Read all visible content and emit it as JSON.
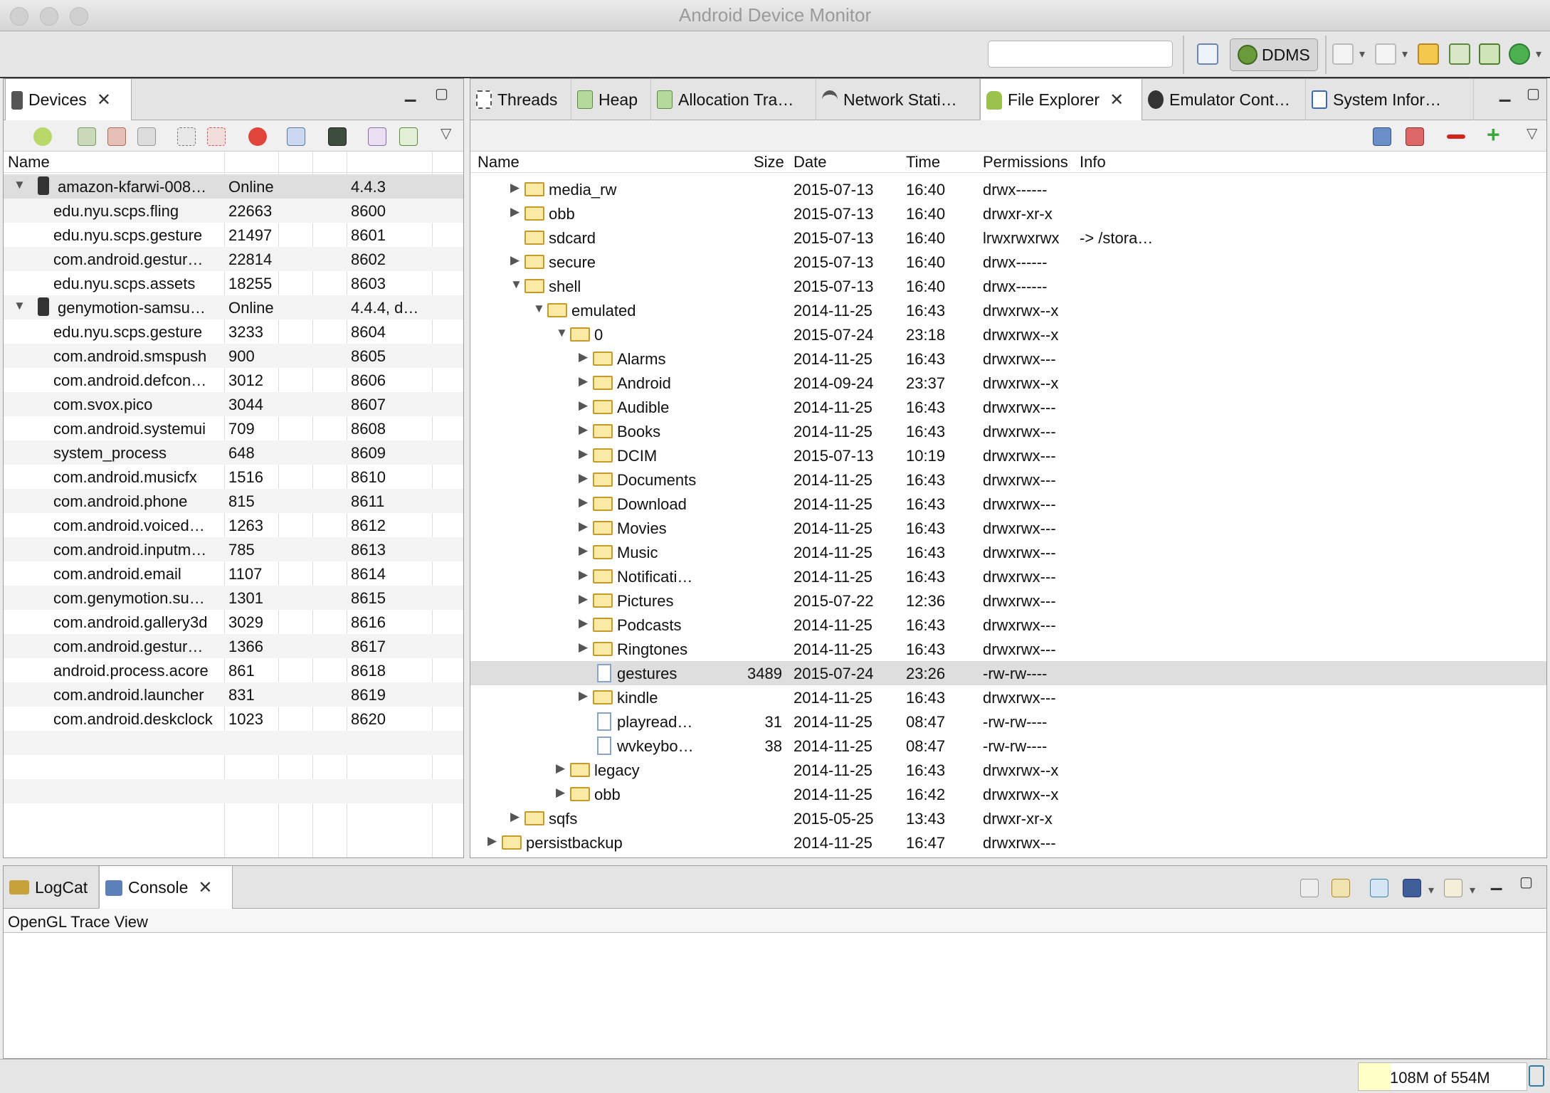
{
  "window": {
    "title": "Android Device Monitor"
  },
  "toolbar": {
    "perspective_label": "DDMS"
  },
  "devices": {
    "tab_label": "Devices",
    "columns": [
      "Name",
      "",
      "",
      "",
      ""
    ],
    "rows": [
      {
        "type": "device",
        "name": "amazon-kfarwi-008…",
        "c2": "Online",
        "c3": "",
        "c4": "4.4.3"
      },
      {
        "type": "process",
        "name": "edu.nyu.scps.fling",
        "c2": "22663",
        "c3": "",
        "c4": "8600"
      },
      {
        "type": "process",
        "name": "edu.nyu.scps.gesture",
        "c2": "21497",
        "c3": "",
        "c4": "8601"
      },
      {
        "type": "process",
        "name": "com.android.gestur…",
        "c2": "22814",
        "c3": "",
        "c4": "8602"
      },
      {
        "type": "process",
        "name": "edu.nyu.scps.assets",
        "c2": "18255",
        "c3": "",
        "c4": "8603"
      },
      {
        "type": "device",
        "name": "genymotion-samsu…",
        "c2": "Online",
        "c3": "",
        "c4": "4.4.4, d…"
      },
      {
        "type": "process",
        "name": "edu.nyu.scps.gesture",
        "c2": "3233",
        "c3": "",
        "c4": "8604"
      },
      {
        "type": "process",
        "name": "com.android.smspush",
        "c2": "900",
        "c3": "",
        "c4": "8605"
      },
      {
        "type": "process",
        "name": "com.android.defcon…",
        "c2": "3012",
        "c3": "",
        "c4": "8606"
      },
      {
        "type": "process",
        "name": "com.svox.pico",
        "c2": "3044",
        "c3": "",
        "c4": "8607"
      },
      {
        "type": "process",
        "name": "com.android.systemui",
        "c2": "709",
        "c3": "",
        "c4": "8608"
      },
      {
        "type": "process",
        "name": "system_process",
        "c2": "648",
        "c3": "",
        "c4": "8609"
      },
      {
        "type": "process",
        "name": "com.android.musicfx",
        "c2": "1516",
        "c3": "",
        "c4": "8610"
      },
      {
        "type": "process",
        "name": "com.android.phone",
        "c2": "815",
        "c3": "",
        "c4": "8611"
      },
      {
        "type": "process",
        "name": "com.android.voiced…",
        "c2": "1263",
        "c3": "",
        "c4": "8612"
      },
      {
        "type": "process",
        "name": "com.android.inputm…",
        "c2": "785",
        "c3": "",
        "c4": "8613"
      },
      {
        "type": "process",
        "name": "com.android.email",
        "c2": "1107",
        "c3": "",
        "c4": "8614"
      },
      {
        "type": "process",
        "name": "com.genymotion.su…",
        "c2": "1301",
        "c3": "",
        "c4": "8615"
      },
      {
        "type": "process",
        "name": "com.android.gallery3d",
        "c2": "3029",
        "c3": "",
        "c4": "8616"
      },
      {
        "type": "process",
        "name": "com.android.gestur…",
        "c2": "1366",
        "c3": "",
        "c4": "8617"
      },
      {
        "type": "process",
        "name": "android.process.acore",
        "c2": "861",
        "c3": "",
        "c4": "8618"
      },
      {
        "type": "process",
        "name": "com.android.launcher",
        "c2": "831",
        "c3": "",
        "c4": "8619"
      },
      {
        "type": "process",
        "name": "com.android.deskclock",
        "c2": "1023",
        "c3": "",
        "c4": "8620"
      },
      {
        "type": "empty",
        "name": "",
        "c2": "",
        "c3": "",
        "c4": ""
      },
      {
        "type": "empty",
        "name": "",
        "c2": "",
        "c3": "",
        "c4": ""
      },
      {
        "type": "empty",
        "name": "",
        "c2": "",
        "c3": "",
        "c4": ""
      },
      {
        "type": "empty",
        "name": "",
        "c2": "",
        "c3": "",
        "c4": ""
      }
    ]
  },
  "right_tabs": [
    {
      "label": "Threads",
      "icon": "threads-icon",
      "active": false
    },
    {
      "label": "Heap",
      "icon": "heap-icon",
      "active": false
    },
    {
      "label": "Allocation Tra…",
      "icon": "allocation-icon",
      "active": false
    },
    {
      "label": "Network Stati…",
      "icon": "network-icon",
      "active": false
    },
    {
      "label": "File Explorer",
      "icon": "android-icon",
      "active": true
    },
    {
      "label": "Emulator Cont…",
      "icon": "emulator-icon",
      "active": false
    },
    {
      "label": "System Infor…",
      "icon": "window-icon",
      "active": false
    }
  ],
  "files": {
    "columns": [
      "Name",
      "Size",
      "Date",
      "Time",
      "Permissions",
      "Info"
    ],
    "rows": [
      {
        "name": "media_rw",
        "size": "",
        "date": "2015-07-13",
        "time": "16:40",
        "perm": "drwx------",
        "info": "",
        "depth": 1,
        "kind": "folder",
        "exp": "closed"
      },
      {
        "name": "obb",
        "size": "",
        "date": "2015-07-13",
        "time": "16:40",
        "perm": "drwxr-xr-x",
        "info": "",
        "depth": 1,
        "kind": "folder",
        "exp": "closed"
      },
      {
        "name": "sdcard",
        "size": "",
        "date": "2015-07-13",
        "time": "16:40",
        "perm": "lrwxrwxrwx",
        "info": "-> /stora…",
        "depth": 1,
        "kind": "folder",
        "exp": "none"
      },
      {
        "name": "secure",
        "size": "",
        "date": "2015-07-13",
        "time": "16:40",
        "perm": "drwx------",
        "info": "",
        "depth": 1,
        "kind": "folder",
        "exp": "closed"
      },
      {
        "name": "shell",
        "size": "",
        "date": "2015-07-13",
        "time": "16:40",
        "perm": "drwx------",
        "info": "",
        "depth": 1,
        "kind": "folder",
        "exp": "open"
      },
      {
        "name": "emulated",
        "size": "",
        "date": "2014-11-25",
        "time": "16:43",
        "perm": "drwxrwx--x",
        "info": "",
        "depth": 2,
        "kind": "folder",
        "exp": "open"
      },
      {
        "name": "0",
        "size": "",
        "date": "2015-07-24",
        "time": "23:18",
        "perm": "drwxrwx--x",
        "info": "",
        "depth": 3,
        "kind": "folder",
        "exp": "open"
      },
      {
        "name": "Alarms",
        "size": "",
        "date": "2014-11-25",
        "time": "16:43",
        "perm": "drwxrwx---",
        "info": "",
        "depth": 4,
        "kind": "folder",
        "exp": "closed"
      },
      {
        "name": "Android",
        "size": "",
        "date": "2014-09-24",
        "time": "23:37",
        "perm": "drwxrwx--x",
        "info": "",
        "depth": 4,
        "kind": "folder",
        "exp": "closed"
      },
      {
        "name": "Audible",
        "size": "",
        "date": "2014-11-25",
        "time": "16:43",
        "perm": "drwxrwx---",
        "info": "",
        "depth": 4,
        "kind": "folder",
        "exp": "closed"
      },
      {
        "name": "Books",
        "size": "",
        "date": "2014-11-25",
        "time": "16:43",
        "perm": "drwxrwx---",
        "info": "",
        "depth": 4,
        "kind": "folder",
        "exp": "closed"
      },
      {
        "name": "DCIM",
        "size": "",
        "date": "2015-07-13",
        "time": "10:19",
        "perm": "drwxrwx---",
        "info": "",
        "depth": 4,
        "kind": "folder",
        "exp": "closed"
      },
      {
        "name": "Documents",
        "size": "",
        "date": "2014-11-25",
        "time": "16:43",
        "perm": "drwxrwx---",
        "info": "",
        "depth": 4,
        "kind": "folder",
        "exp": "closed"
      },
      {
        "name": "Download",
        "size": "",
        "date": "2014-11-25",
        "time": "16:43",
        "perm": "drwxrwx---",
        "info": "",
        "depth": 4,
        "kind": "folder",
        "exp": "closed"
      },
      {
        "name": "Movies",
        "size": "",
        "date": "2014-11-25",
        "time": "16:43",
        "perm": "drwxrwx---",
        "info": "",
        "depth": 4,
        "kind": "folder",
        "exp": "closed"
      },
      {
        "name": "Music",
        "size": "",
        "date": "2014-11-25",
        "time": "16:43",
        "perm": "drwxrwx---",
        "info": "",
        "depth": 4,
        "kind": "folder",
        "exp": "closed"
      },
      {
        "name": "Notificati…",
        "size": "",
        "date": "2014-11-25",
        "time": "16:43",
        "perm": "drwxrwx---",
        "info": "",
        "depth": 4,
        "kind": "folder",
        "exp": "closed"
      },
      {
        "name": "Pictures",
        "size": "",
        "date": "2015-07-22",
        "time": "12:36",
        "perm": "drwxrwx---",
        "info": "",
        "depth": 4,
        "kind": "folder",
        "exp": "closed"
      },
      {
        "name": "Podcasts",
        "size": "",
        "date": "2014-11-25",
        "time": "16:43",
        "perm": "drwxrwx---",
        "info": "",
        "depth": 4,
        "kind": "folder",
        "exp": "closed"
      },
      {
        "name": "Ringtones",
        "size": "",
        "date": "2014-11-25",
        "time": "16:43",
        "perm": "drwxrwx---",
        "info": "",
        "depth": 4,
        "kind": "folder",
        "exp": "closed"
      },
      {
        "name": "gestures",
        "size": "3489",
        "date": "2015-07-24",
        "time": "23:26",
        "perm": "-rw-rw----",
        "info": "",
        "depth": 4,
        "kind": "file",
        "exp": "none",
        "selected": true
      },
      {
        "name": "kindle",
        "size": "",
        "date": "2014-11-25",
        "time": "16:43",
        "perm": "drwxrwx---",
        "info": "",
        "depth": 4,
        "kind": "folder",
        "exp": "closed"
      },
      {
        "name": "playread…",
        "size": "31",
        "date": "2014-11-25",
        "time": "08:47",
        "perm": "-rw-rw----",
        "info": "",
        "depth": 4,
        "kind": "file",
        "exp": "none"
      },
      {
        "name": "wvkeybo…",
        "size": "38",
        "date": "2014-11-25",
        "time": "08:47",
        "perm": "-rw-rw----",
        "info": "",
        "depth": 4,
        "kind": "file",
        "exp": "none"
      },
      {
        "name": "legacy",
        "size": "",
        "date": "2014-11-25",
        "time": "16:43",
        "perm": "drwxrwx--x",
        "info": "",
        "depth": 3,
        "kind": "folder",
        "exp": "closed"
      },
      {
        "name": "obb",
        "size": "",
        "date": "2014-11-25",
        "time": "16:42",
        "perm": "drwxrwx--x",
        "info": "",
        "depth": 3,
        "kind": "folder",
        "exp": "closed"
      },
      {
        "name": "sqfs",
        "size": "",
        "date": "2015-05-25",
        "time": "13:43",
        "perm": "drwxr-xr-x",
        "info": "",
        "depth": 1,
        "kind": "folder",
        "exp": "closed"
      },
      {
        "name": "persistbackup",
        "size": "",
        "date": "2014-11-25",
        "time": "16:47",
        "perm": "drwxrwx---",
        "info": "",
        "depth": 0,
        "kind": "folder",
        "exp": "closed"
      }
    ]
  },
  "bottom": {
    "tabs": [
      {
        "label": "LogCat",
        "active": false
      },
      {
        "label": "Console",
        "active": true
      }
    ],
    "console_title": "OpenGL Trace View"
  },
  "status": {
    "memory": "108M of 554M",
    "memory_used_fraction": 0.19
  }
}
